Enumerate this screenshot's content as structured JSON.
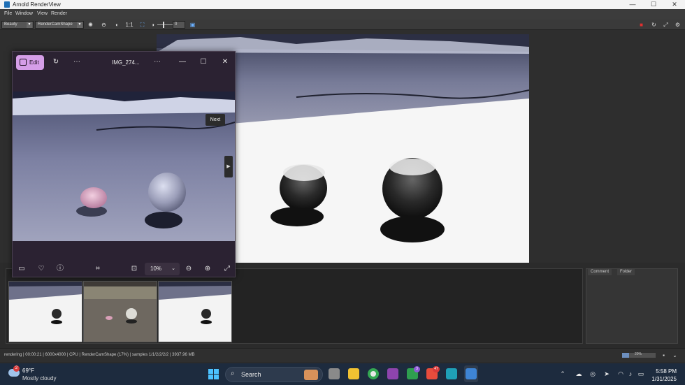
{
  "window": {
    "title": "Arnold RenderView"
  },
  "menu": [
    "File",
    "Window",
    "View",
    "Render"
  ],
  "toolbar": {
    "aov": "Beauty",
    "camera": "RenderCamShape",
    "ratio": "1:1",
    "exposure": "0"
  },
  "photos": {
    "edit_label": "Edit",
    "filename": "IMG_274...",
    "tooltip": "Next",
    "zoom": "10%"
  },
  "right_panel": {
    "tabs": [
      "Comment",
      "Folder"
    ]
  },
  "status": {
    "text": "rendering | 00:00:21 | 6000x4000 | CPU | RenderCamShape (17%) | samples 1/1/2/2/2/2 | 3937.96 MB",
    "progress_label": "20%",
    "progress": 0.2
  },
  "taskbar": {
    "weather_temp": "69°F",
    "weather_cond": "Mostly cloudy",
    "weather_badge": "2",
    "search": "Search",
    "badge_xbox": "3",
    "badge_app": "47",
    "time": "5:58 PM",
    "date": "1/31/2025"
  }
}
